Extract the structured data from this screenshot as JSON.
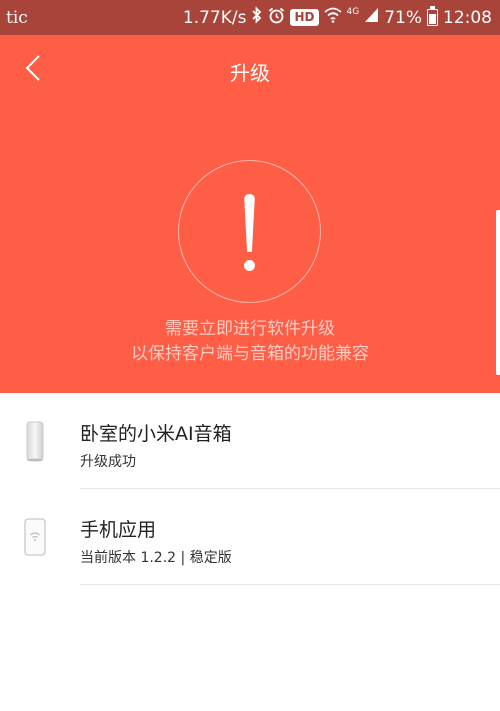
{
  "status_bar": {
    "carrier": "tic",
    "speed": "1.77K/s",
    "hd": "HD",
    "network": "4G",
    "battery": "71%",
    "time": "12:08"
  },
  "header": {
    "title": "升级",
    "back_icon": "chevron-left-icon"
  },
  "alert": {
    "icon": "exclamation-icon",
    "line1": "需要立即进行软件升级",
    "line2": "以保持客户端与音箱的功能兼容"
  },
  "devices": [
    {
      "name": "卧室的小米AI音箱",
      "status": "升级成功",
      "icon": "speaker-icon"
    },
    {
      "name": "手机应用",
      "status": "当前版本 1.2.2 | 稳定版",
      "icon": "phone-icon"
    }
  ],
  "colors": {
    "accent": "#ff5e46",
    "status_bar": "#a8443a"
  }
}
